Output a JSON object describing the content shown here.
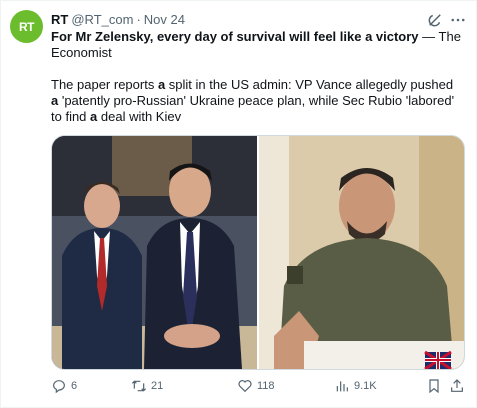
{
  "post": {
    "avatar_text": "RT",
    "author_name": "RT",
    "handle": "@RT_com",
    "separator": "·",
    "date": "Nov 24",
    "headline_bold": "For Mr Zelensky, every day of survival will feel like a victory",
    "headline_rest": " — The Economist",
    "body_1": "The paper reports ",
    "body_b1": "a",
    "body_2": " split in the US admin: VP Vance allegedly pushed ",
    "body_b2": "a",
    "body_3": " 'patently pro-Russian' Ukraine peace plan, while Sec Rubio 'labored' to find ",
    "body_b3": "a",
    "body_4": " deal with Kiev"
  },
  "actions": {
    "replies": "6",
    "reposts": "21",
    "likes": "118",
    "views": "9.1K"
  },
  "colors": {
    "avatar": "#6cbd2d",
    "text": "#0f1419",
    "muted": "#536471",
    "border": "#cfd9de"
  },
  "icons": [
    "grok-icon",
    "more-icon",
    "reply-icon",
    "repost-icon",
    "like-icon",
    "views-icon",
    "bookmark-icon",
    "share-icon"
  ]
}
